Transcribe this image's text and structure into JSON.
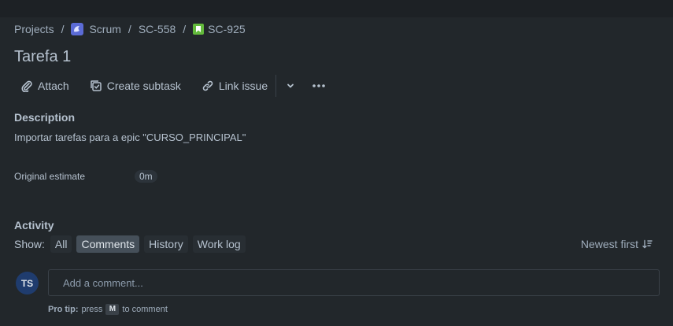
{
  "breadcrumb": {
    "projects": "Projects",
    "separator": "/",
    "project": "Scrum",
    "epic": "SC-558",
    "issue": "SC-925"
  },
  "issue": {
    "title": "Tarefa 1"
  },
  "toolbar": {
    "attach": "Attach",
    "create_subtask": "Create subtask",
    "link_issue": "Link issue"
  },
  "description": {
    "heading": "Description",
    "text": "Importar tarefas para a epic \"CURSO_PRINCIPAL\""
  },
  "fields": {
    "original_estimate_label": "Original estimate",
    "original_estimate_value": "0m"
  },
  "activity": {
    "heading": "Activity",
    "show_label": "Show:",
    "filters": [
      "All",
      "Comments",
      "History",
      "Work log"
    ],
    "active_filter": "Comments",
    "sort": "Newest first"
  },
  "comment": {
    "avatar_initials": "TS",
    "placeholder": "Add a comment...",
    "pro_tip_label": "Pro tip:",
    "pro_tip_press": "press",
    "pro_tip_key": "M",
    "pro_tip_suffix": "to comment"
  },
  "colors": {
    "background": "#22272b",
    "text": "#b6c2cf",
    "project_icon": "#5b6bd6",
    "story_icon": "#63ba3c",
    "avatar": "#1f3c6e"
  }
}
